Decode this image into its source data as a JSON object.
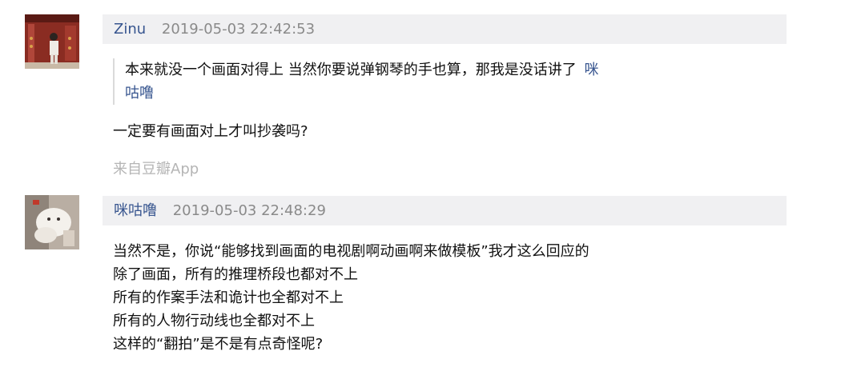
{
  "comments": [
    {
      "username": "Zinu",
      "timestamp": "2019-05-03 22:42:53",
      "quote_text": "本来就没一个画面对得上 当然你要说弹钢琴的手也算，那我是没话讲了",
      "quote_author": "咪咕噜",
      "text": "一定要有画面对上才叫抄袭吗?",
      "source": "来自豆瓣App"
    },
    {
      "username": "咪咕噜",
      "timestamp": "2019-05-03 22:48:29",
      "lines": [
        "当然不是，你说“能够找到画面的电视剧啊动画啊来做模板”我才这么回应的",
        "除了画面，所有的推理桥段也都对不上",
        "所有的作案手法和诡计也全都对不上",
        "所有的人物行动线也全都对不上",
        "这样的“翻拍”是不是有点奇怪呢?"
      ]
    }
  ]
}
